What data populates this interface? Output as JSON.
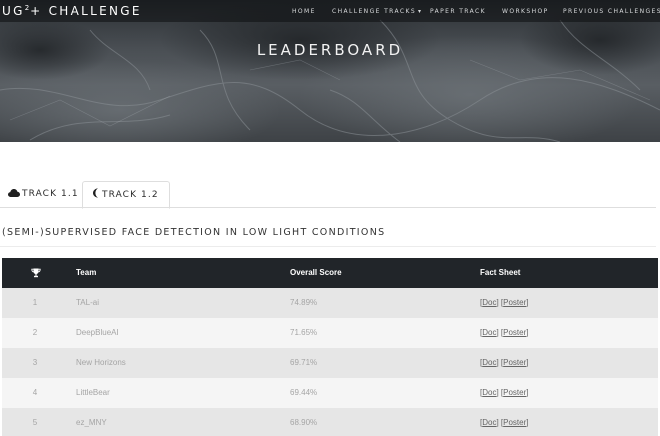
{
  "header": {
    "logo_main": "UG",
    "logo_sup": "2",
    "logo_rest": "+ CHALLENGE",
    "nav": [
      {
        "label": "HOME"
      },
      {
        "label": "CHALLENGE TRACKS",
        "caret": "▾"
      },
      {
        "label": "PAPER TRACK"
      },
      {
        "label": "WORKSHOP"
      },
      {
        "label": "PREVIOUS CHALLENGES"
      }
    ],
    "title": "LEADERBOARD"
  },
  "tabs": [
    {
      "label": "TRACK 1.1",
      "icon": "cloud-icon",
      "active": false
    },
    {
      "label": "TRACK 1.2",
      "icon": "moon-icon",
      "active": true
    }
  ],
  "section": {
    "title": "(SEMI-)SUPERVISED FACE DETECTION IN LOW LIGHT CONDITIONS"
  },
  "table": {
    "rank_header_icon": "trophy-icon",
    "columns": [
      "Team",
      "Overall Score",
      "Fact Sheet"
    ],
    "rows": [
      {
        "rank": "1",
        "team": "TAL-ai",
        "score": "74.89%",
        "doc": "Doc",
        "poster": "Poster"
      },
      {
        "rank": "2",
        "team": "DeepBlueAI",
        "score": "71.65%",
        "doc": "Doc",
        "poster": "Poster"
      },
      {
        "rank": "3",
        "team": "New Horizons",
        "score": "69.71%",
        "doc": "Doc",
        "poster": "Poster"
      },
      {
        "rank": "4",
        "team": "LittleBear",
        "score": "69.44%",
        "doc": "Doc",
        "poster": "Poster"
      },
      {
        "rank": "5",
        "team": "ez_MNY",
        "score": "68.90%",
        "doc": "Doc",
        "poster": "Poster"
      }
    ]
  },
  "colors": {
    "table_header_bg": "#212529",
    "row_odd_bg": "#e6e6e6",
    "row_even_bg": "#f5f5f5",
    "hero_bg": "#4a4f54"
  }
}
